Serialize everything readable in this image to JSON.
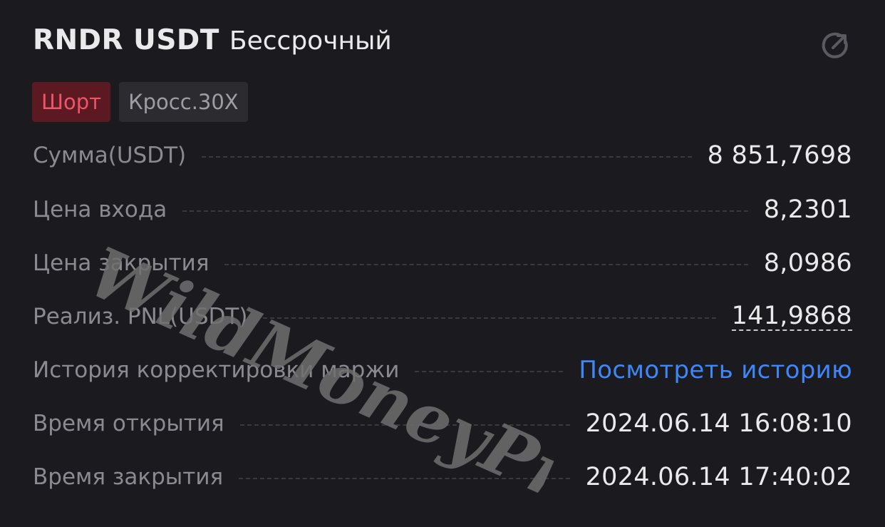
{
  "header": {
    "symbol": "RNDR USDT",
    "product_type": "Бессрочный",
    "share_icon": "share-icon"
  },
  "tags": {
    "side": "Шорт",
    "margin_mode": "Кросс.30X"
  },
  "rows": [
    {
      "label": "Сумма(USDT)",
      "value": "8 851,7698"
    },
    {
      "label": "Цена входа",
      "value": "8,2301"
    },
    {
      "label": "Цена закрытия",
      "value": "8,0986"
    },
    {
      "label": "Реализ. PNL(USDT)",
      "value": "141,9868"
    },
    {
      "label": "История корректировки маржи",
      "value": "Посмотреть историю"
    },
    {
      "label": "Время открытия",
      "value": "2024.06.14 16:08:10"
    },
    {
      "label": "Время закрытия",
      "value": "2024.06.14 17:40:02"
    }
  ],
  "watermark": "WildMoneyPro",
  "colors": {
    "background": "#1b1b1f",
    "short": "#f0546a",
    "short_bg": "#5b1a22",
    "link": "#3f86f6"
  }
}
